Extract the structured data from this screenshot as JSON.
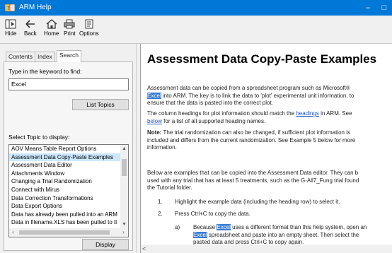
{
  "window": {
    "title": "ARM Help",
    "minimize_label": "–",
    "maximize_label": "□"
  },
  "toolbar": {
    "hide_label": "Hide",
    "back_label": "Back",
    "home_label": "Home",
    "print_label": "Print",
    "options_label": "Options"
  },
  "tabs": {
    "contents": "Contents",
    "index": "Index",
    "search": "Search"
  },
  "search_panel": {
    "keyword_label": "Type in the keyword to find:",
    "keyword_value": "Excel",
    "list_topics_button": "List Topics",
    "select_topic_label": "Select Topic to display:",
    "topics": [
      "AOV Means Table Report Options",
      "Assessment Data Copy-Paste Examples",
      "Assessment Data Editor",
      "Attachments Window",
      "Changing a Trial Randomization",
      "Connect with Mirus",
      "Data Correction Transformations",
      "Data Export Options",
      "Data has already been pulled into an ARM",
      "Data in filename.XLS has been pulled to tl"
    ],
    "selected_index": 1,
    "display_button": "Display"
  },
  "content": {
    "title": "Assessment Data Copy-Paste Examples",
    "p1_a": "Assessment data can be copied from a spreadsheet program such as Microsoft®",
    "p1_b_hl": "Excel",
    "p1_b": "into ARM. The key is to link the data to 'plot' experimental unit information, to",
    "p1_c": "ensure that the data is pasted into the correct plot.",
    "p2_a": "The column headings for plot information should match the",
    "p2_link": "headings",
    "p2_b": "in ARM. See",
    "p2_link2": "below",
    "p2_c": "for a list of all supported heading names.",
    "note_label": "Note:",
    "note_a": "The trial randomization can also be changed, if sufficient plot information is",
    "note_b": "included and differs from the current randomization. See Example 5 below for more",
    "note_c": "information.",
    "p3_a": "Below are examples that can be copied into the Assessment Data editor. They can b",
    "p3_b": "used with any trial that has at least 5 treatments, such as the G-All7_Fung trial found",
    "p3_c": "the Tutorial folder.",
    "step1_num": "1.",
    "step1": "Highlight the example data (including the heading row) to select it.",
    "step2_num": "2.",
    "step2": "Press Ctrl+C to copy the data.",
    "suba_num": "a)",
    "suba_a1": "Because",
    "suba_hl1": "Excel",
    "suba_a2": "uses a different format than this help system, open an",
    "suba_hl2": "Excel",
    "suba_b": "spreadsheet and paste into an empty sheet. Then select the",
    "suba_c": "pasted data and press Ctrl+C to copy again.",
    "scroll_left": "<"
  }
}
